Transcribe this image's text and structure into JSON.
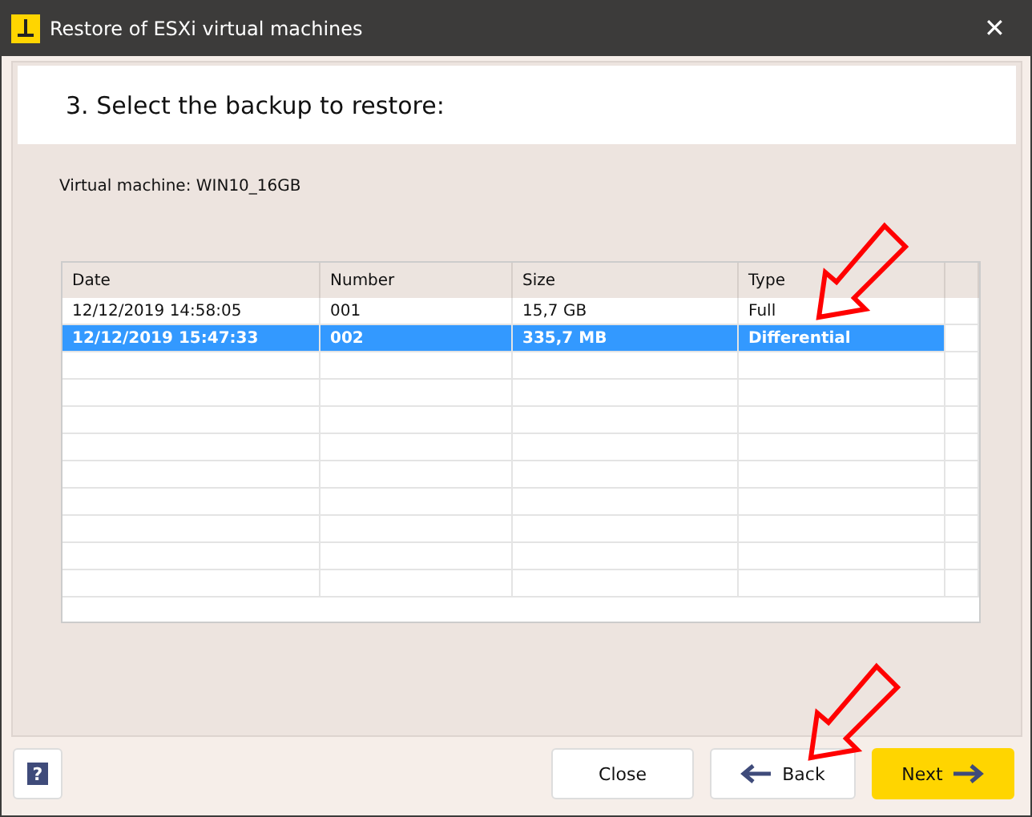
{
  "window": {
    "title": "Restore of ESXi virtual machines",
    "close": "✕"
  },
  "step_title": "3. Select the backup to restore:",
  "virtual_machine": "Virtual machine: WIN10_16GB",
  "table": {
    "columns": [
      "Date",
      "Number",
      "Size",
      "Type"
    ],
    "rows": [
      {
        "cells": [
          "12/12/2019 14:58:05",
          "001",
          "15,7 GB",
          "Full"
        ],
        "selected": false
      },
      {
        "cells": [
          "12/12/2019 15:47:33",
          "002",
          "335,7 MB",
          "Differential"
        ],
        "selected": true
      }
    ]
  },
  "buttons": {
    "help": "?",
    "close": "Close",
    "back": "Back",
    "next": "Next"
  }
}
